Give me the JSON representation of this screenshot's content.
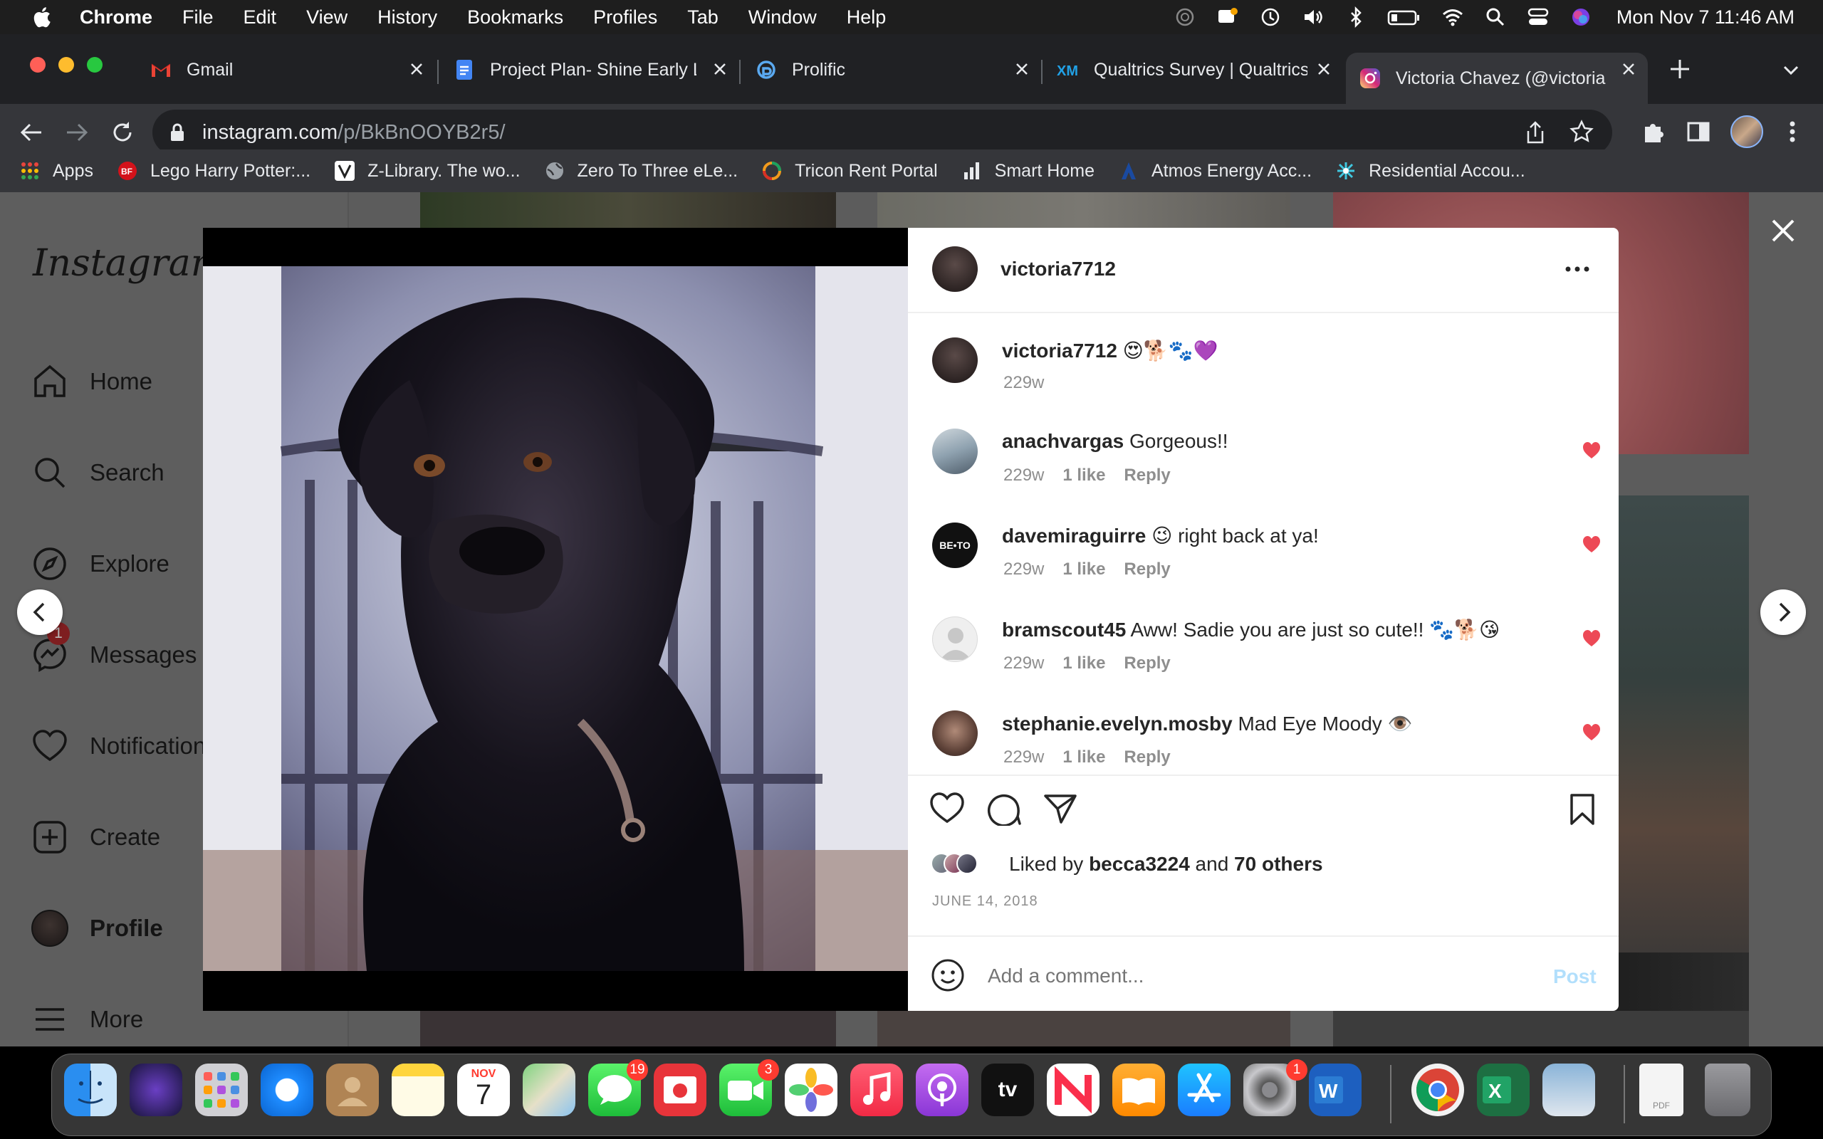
{
  "menubar": {
    "items": [
      "Chrome",
      "File",
      "Edit",
      "View",
      "History",
      "Bookmarks",
      "Profiles",
      "Tab",
      "Window",
      "Help"
    ],
    "clock": "Mon Nov 7  11:46 AM"
  },
  "tabs": [
    {
      "title": "Gmail",
      "icon": "gmail-icon"
    },
    {
      "title": "Project Plan- Shine Early L",
      "icon": "docs-icon"
    },
    {
      "title": "Prolific",
      "icon": "prolific-icon"
    },
    {
      "title": "Qualtrics Survey | Qualtrics",
      "icon": "qualtrics-icon"
    },
    {
      "title": "Victoria Chavez (@victoria",
      "icon": "instagram-icon"
    }
  ],
  "url": {
    "host": "instagram.com",
    "path": "/p/BkBnOOYB2r5/"
  },
  "bookmarks": [
    {
      "label": "Apps",
      "color": "#e8453c"
    },
    {
      "label": "Lego Harry Potter:...",
      "color": "#d3121a"
    },
    {
      "label": "Z-Library. The wo...",
      "color": "#ffffff"
    },
    {
      "label": "Zero To Three eLe...",
      "color": "#9aa0a6"
    },
    {
      "label": "Tricon Rent Portal",
      "color": "#f29a1c"
    },
    {
      "label": "Smart Home",
      "color": "#e8eaed"
    },
    {
      "label": "Atmos Energy Acc...",
      "color": "#1a4aa0"
    },
    {
      "label": "Residential Accou...",
      "color": "#40c8e0"
    }
  ],
  "sidebar": {
    "logo": "Instagram",
    "items": [
      {
        "label": "Home",
        "icon": "home-icon"
      },
      {
        "label": "Search",
        "icon": "search-icon"
      },
      {
        "label": "Explore",
        "icon": "explore-icon"
      },
      {
        "label": "Messages",
        "icon": "messages-icon",
        "badge": "1"
      },
      {
        "label": "Notifications",
        "icon": "heart-icon"
      },
      {
        "label": "Create",
        "icon": "create-icon"
      },
      {
        "label": "Profile",
        "icon": "profile-avatar"
      },
      {
        "label": "More",
        "icon": "menu-icon"
      }
    ]
  },
  "post": {
    "author": "victoria7712",
    "caption": {
      "user": "victoria7712",
      "text": "😍🐕🐾💜",
      "age": "229w"
    },
    "comments": [
      {
        "user": "anachvargas",
        "text": "Gorgeous!!",
        "age": "229w",
        "likes": "1 like",
        "reply": "Reply"
      },
      {
        "user": "davemiraguirre",
        "text": "😉 right back at ya!",
        "age": "229w",
        "likes": "1 like",
        "reply": "Reply",
        "avatar_text": "BE•TO"
      },
      {
        "user": "bramscout45",
        "text": "Aww! Sadie you are just so cute!! 🐾🐕😘",
        "age": "229w",
        "likes": "1 like",
        "reply": "Reply"
      },
      {
        "user": "stephanie.evelyn.mosby",
        "text": "Mad Eye Moody 👁️",
        "age": "229w",
        "likes": "1 like",
        "reply": "Reply"
      }
    ],
    "liked_by_prefix": "Liked by",
    "liked_by_user": "becca3224",
    "liked_by_and": "and",
    "liked_by_others": "70 others",
    "date": "JUNE 14, 2018",
    "comment_placeholder": "Add a comment...",
    "post_label": "Post"
  },
  "dock": {
    "calendar_month": "NOV",
    "calendar_day": "7",
    "badges": {
      "messages": "19",
      "facetime": "3",
      "settings": "1"
    }
  },
  "colors": {
    "like_red": "#ed4956",
    "post_blue": "#b2dffc",
    "chrome_dark": "#202124"
  }
}
